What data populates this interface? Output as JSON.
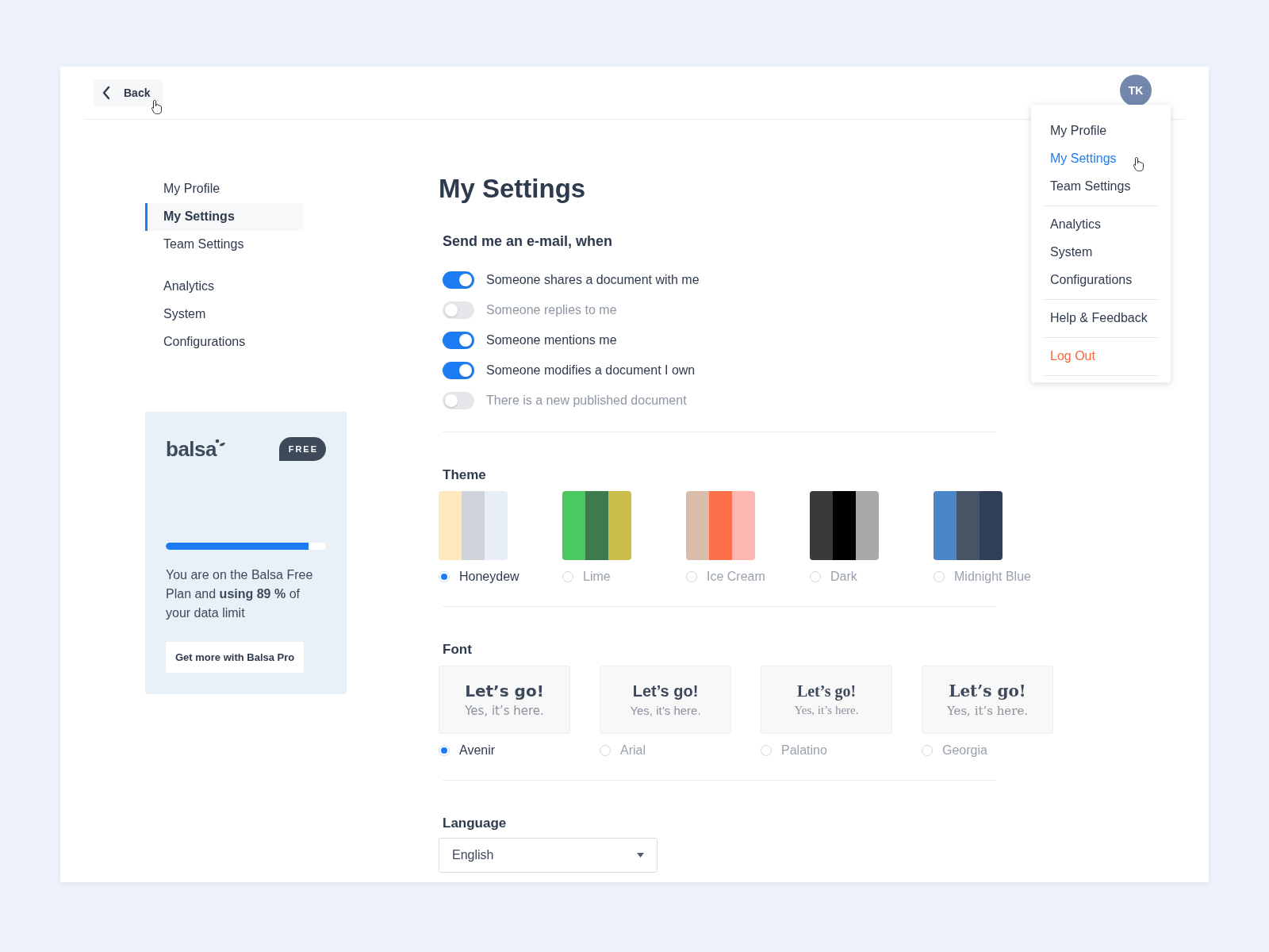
{
  "header": {
    "back_label": "Back",
    "avatar_initials": "TK"
  },
  "user_menu": {
    "groups": [
      [
        {
          "label": "My Profile",
          "selected": false,
          "kind": "link"
        },
        {
          "label": "My Settings",
          "selected": true,
          "kind": "link"
        },
        {
          "label": "Team Settings",
          "selected": false,
          "kind": "link"
        }
      ],
      [
        {
          "label": "Analytics",
          "selected": false,
          "kind": "link"
        },
        {
          "label": "System",
          "selected": false,
          "kind": "link"
        },
        {
          "label": "Configurations",
          "selected": false,
          "kind": "link"
        }
      ],
      [
        {
          "label": "Help & Feedback",
          "selected": false,
          "kind": "link"
        }
      ],
      [
        {
          "label": "Log Out",
          "selected": false,
          "kind": "danger"
        }
      ]
    ]
  },
  "sidebar": {
    "groups": [
      [
        {
          "label": "My Profile",
          "selected": false
        },
        {
          "label": "My Settings",
          "selected": true
        },
        {
          "label": "Team Settings",
          "selected": false
        }
      ],
      [
        {
          "label": "Analytics",
          "selected": false
        },
        {
          "label": "System",
          "selected": false
        },
        {
          "label": "Configurations",
          "selected": false
        }
      ]
    ]
  },
  "promo": {
    "logo": "balsa",
    "badge": "FREE",
    "usage": {
      "level": 0.89
    },
    "message": "You are on the Balsa Free Plan and **using 89 %** of your data limit",
    "button": "Get more with Balsa Pro"
  },
  "main": {
    "title": "My Settings",
    "email": {
      "heading": "Send me an e-mail, when",
      "options": [
        {
          "label": "Someone shares a document with me",
          "on": true
        },
        {
          "label": "Someone replies to me",
          "on": false
        },
        {
          "label": "Someone mentions me",
          "on": true
        },
        {
          "label": "Someone modifies a document I own",
          "on": true
        },
        {
          "label": "There is a new published document",
          "on": false
        }
      ]
    },
    "theme": {
      "heading": "Theme",
      "options": [
        {
          "label": "Honeydew",
          "selected": true,
          "stripes": [
            {
              "color": "#fde9bd"
            },
            {
              "color": "#d0d4da"
            },
            {
              "color": "#e8eff8"
            }
          ]
        },
        {
          "label": "Lime",
          "selected": false,
          "stripes": [
            {
              "color": "#4bc862"
            },
            {
              "color": "#3d7a4d"
            },
            {
              "color": "#c9bd4c"
            }
          ]
        },
        {
          "label": "Ice Cream",
          "selected": false,
          "stripes": [
            {
              "color": "#d9bca9"
            },
            {
              "color": "#fc7149"
            },
            {
              "color": "#feb6b2"
            }
          ]
        },
        {
          "label": "Dark",
          "selected": false,
          "stripes": [
            {
              "color": "#3a3a3a"
            },
            {
              "color": "#000000"
            },
            {
              "color": "#a9a9a9"
            }
          ]
        },
        {
          "label": "Midnight Blue",
          "selected": false,
          "stripes": [
            {
              "color": "#4a86c8"
            },
            {
              "color": "#475466"
            },
            {
              "color": "#2e3f57"
            }
          ]
        }
      ]
    },
    "font": {
      "heading": "Font",
      "options": [
        {
          "label": "Avenir",
          "selected": true,
          "kind": "geometric",
          "sample_title": "Let’s go!",
          "sample_text": "Yes, it’s here."
        },
        {
          "label": "Arial",
          "selected": false,
          "kind": "grotesque",
          "sample_title": "Let’s go!",
          "sample_text": "Yes, it’s here."
        },
        {
          "label": "Palatino",
          "selected": false,
          "kind": "oldstyle",
          "sample_title": "Let’s go!",
          "sample_text": "Yes, it’s here."
        },
        {
          "label": "Georgia",
          "selected": false,
          "kind": "transitional",
          "sample_title": "Let’s go!",
          "sample_text": "Yes, it’s here."
        }
      ]
    },
    "language": {
      "heading": "Language",
      "value": "English"
    }
  }
}
